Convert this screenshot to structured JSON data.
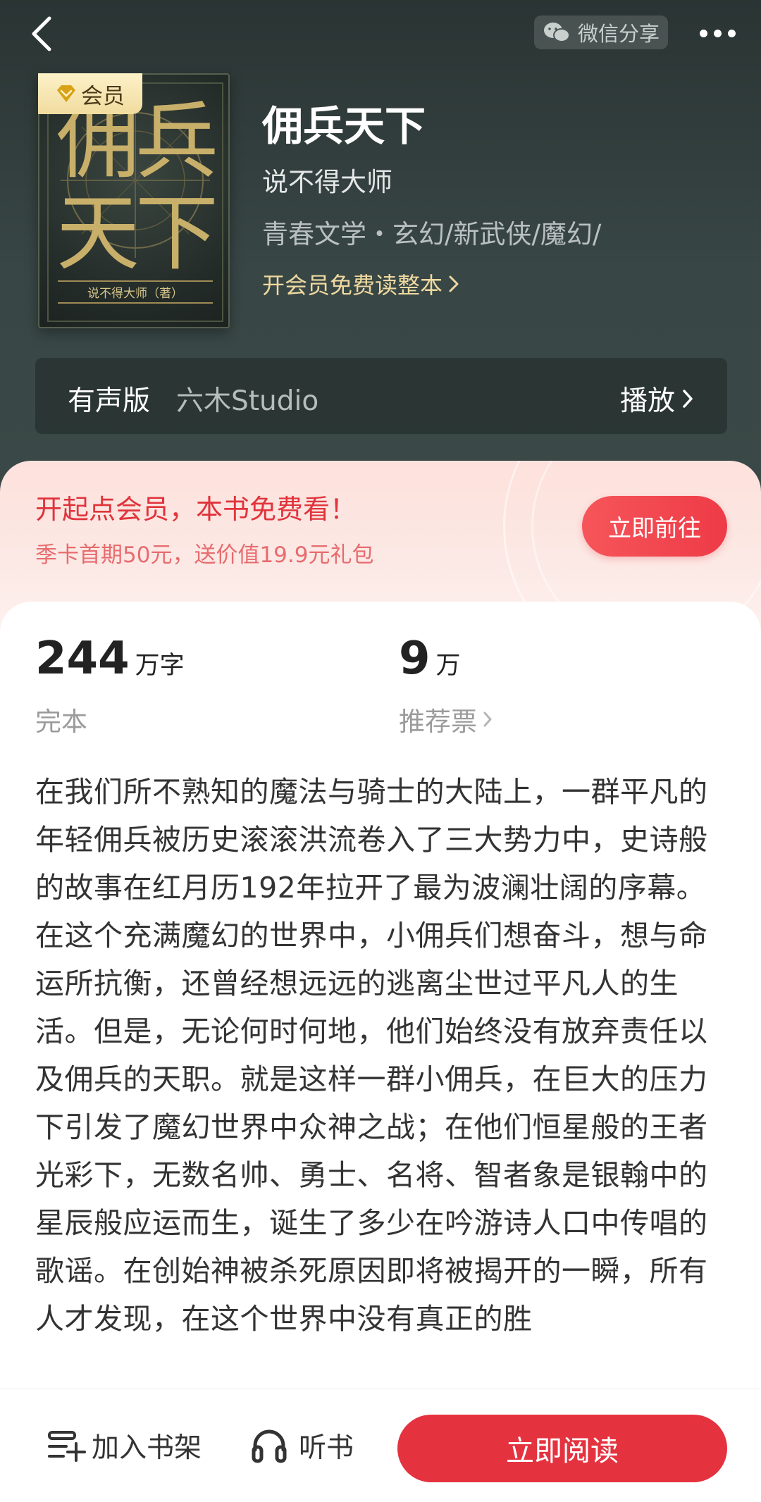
{
  "nav": {
    "share_label": "微信分享"
  },
  "book": {
    "cover_title_line1": "佣兵",
    "cover_title_line2": "天下",
    "cover_author": "说不得大师（著）",
    "vip_badge": "会员",
    "title": "佣兵天下",
    "author": "说不得大师",
    "categories": "青春文学・玄幻/新武侠/魔幻/",
    "vip_link": "开会员免费读整本"
  },
  "audio": {
    "label": "有声版",
    "studio": "六木Studio",
    "play_label": "播放"
  },
  "promo": {
    "title": "开起点会员，本书免费看！",
    "subtitle": "季卡首期50元，送价值19.9元礼包",
    "button": "立即前往"
  },
  "stats": {
    "words_value": "244",
    "words_unit": "万字",
    "status": "完本",
    "votes_value": "9",
    "votes_unit": "万",
    "votes_label": "推荐票"
  },
  "description": "在我们所不熟知的魔法与骑士的大陆上，一群平凡的年轻佣兵被历史滚滚洪流卷入了三大势力中，史诗般的故事在红月历192年拉开了最为波澜壮阔的序幕。在这个充满魔幻的世界中，小佣兵们想奋斗，想与命运所抗衡，还曾经想远远的逃离尘世过平凡人的生活。但是，无论何时何地，他们始终没有放弃责任以及佣兵的天职。就是这样一群小佣兵，在巨大的压力下引发了魔幻世界中众神之战；在他们恒星般的王者光彩下，无数名帅、勇士、名将、智者象是银翰中的星辰般应运而生，诞生了多少在吟游诗人口中传唱的歌谣。在创始神被杀死原因即将被揭开的一瞬，所有人才发现，在这个世界中没有真正的胜",
  "bottom": {
    "shelf_label": "加入书架",
    "listen_label": "听书",
    "read_label": "立即阅读"
  },
  "colors": {
    "accent": "#e5323f",
    "promo_text": "#e0343c",
    "gold": "#efd9a0"
  }
}
